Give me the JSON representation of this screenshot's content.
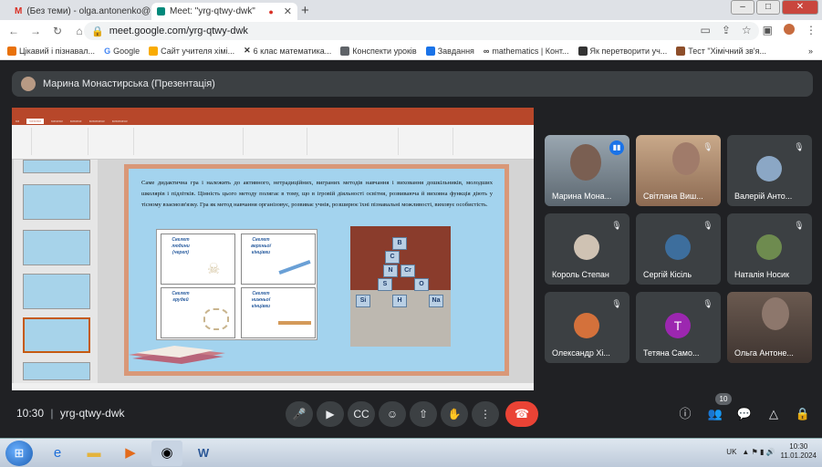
{
  "browser": {
    "tabs": [
      {
        "label": "(Без теми) - olga.antonenko@g",
        "active": false
      },
      {
        "label": "Meet: \"yrg-qtwy-dwk\"",
        "active": true
      }
    ],
    "url": "meet.google.com/yrg-qtwy-dwk",
    "bookmarks": [
      "Цікавий і пізнавал...",
      "Google",
      "Сайт учителя хімі...",
      "6 клас математика...",
      "Конспекти уроків",
      "Завдання",
      "mathematics | Конт...",
      "Як перетворити уч...",
      "Тест \"Хімічний зв'я..."
    ],
    "chevron": "»"
  },
  "meet": {
    "presenter_label": "Марина Монастирська (Презентація)",
    "meeting_code": "yrg-qtwy-dwk",
    "time": "10:30",
    "separator": "|",
    "people_count": "10",
    "participants": [
      {
        "name": "Марина Мона...",
        "speaking": true,
        "avatar_color": "#7a5f52"
      },
      {
        "name": "Світлана Виш...",
        "muted": true,
        "avatar_color": "#a07b6a"
      },
      {
        "name": "Валерій Анто...",
        "muted": true,
        "avatar_color": "#8ba7c5"
      },
      {
        "name": "Король Степан",
        "muted": true,
        "avatar_color": "#cfc2b3"
      },
      {
        "name": "Сергій Кісіль",
        "muted": true,
        "avatar_color": "#3d6e9d"
      },
      {
        "name": "Наталія Носик",
        "muted": true,
        "avatar_color": "#6e8b4f"
      },
      {
        "name": "Олександр Хі...",
        "muted": true,
        "avatar_color": "#d4713b"
      },
      {
        "name": "Тетяна Само...",
        "muted": true,
        "initial": "Т",
        "avatar_color": "#9c27b0"
      },
      {
        "name": "Ольга Антоне...",
        "muted": false,
        "avatar_color": "#6e5f5a"
      }
    ]
  },
  "slide": {
    "paragraph": "Саме дидактична гра і належить до активного, нетрадиційних, виграних методів навчання і виховання дошкільників, молодших школярів і підлітків. Цінність цього методу полягає в тому, що в ігровій діяльності освітня, розвиваюча й виховна функція діють у тісному взаємозв'язку. Гра як метод навчання організовує, розвиває учнів, розширює їхні пізнавальні можливості, виховує особистість.",
    "puzzle_captions": [
      "Скелет людини (череп)",
      "Скелет верхньої кінцівки",
      "Скелет грудей",
      "Скелет нижньої кінцівки"
    ],
    "cube_letters": [
      "B",
      "C",
      "Cr",
      "N",
      "S",
      "O",
      "Si",
      "H",
      "Na"
    ]
  },
  "colors": {
    "meet_bg": "#202124",
    "tile_bg": "#3c4043",
    "end_call": "#ea4335",
    "ppt_accent": "#b7472a",
    "slide_frame": "#d99878",
    "slide_bg": "#a3d3ee"
  },
  "taskbar": {
    "lang": "UK",
    "clock_time": "10:30",
    "clock_date": "11.01.2024"
  }
}
